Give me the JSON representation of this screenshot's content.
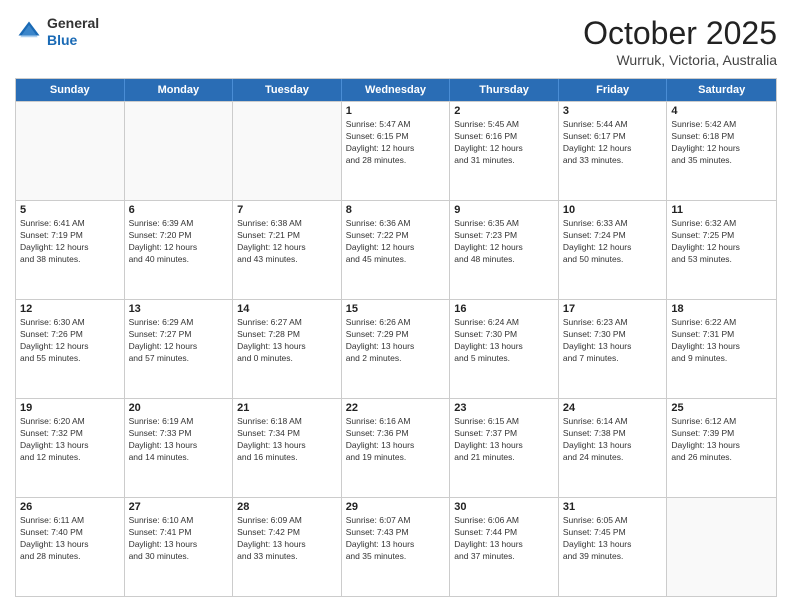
{
  "header": {
    "logo_line1": "General",
    "logo_line2": "Blue",
    "title": "October 2025",
    "location": "Wurruk, Victoria, Australia"
  },
  "weekdays": [
    "Sunday",
    "Monday",
    "Tuesday",
    "Wednesday",
    "Thursday",
    "Friday",
    "Saturday"
  ],
  "rows": [
    [
      {
        "day": "",
        "info": ""
      },
      {
        "day": "",
        "info": ""
      },
      {
        "day": "",
        "info": ""
      },
      {
        "day": "1",
        "info": "Sunrise: 5:47 AM\nSunset: 6:15 PM\nDaylight: 12 hours\nand 28 minutes."
      },
      {
        "day": "2",
        "info": "Sunrise: 5:45 AM\nSunset: 6:16 PM\nDaylight: 12 hours\nand 31 minutes."
      },
      {
        "day": "3",
        "info": "Sunrise: 5:44 AM\nSunset: 6:17 PM\nDaylight: 12 hours\nand 33 minutes."
      },
      {
        "day": "4",
        "info": "Sunrise: 5:42 AM\nSunset: 6:18 PM\nDaylight: 12 hours\nand 35 minutes."
      }
    ],
    [
      {
        "day": "5",
        "info": "Sunrise: 6:41 AM\nSunset: 7:19 PM\nDaylight: 12 hours\nand 38 minutes."
      },
      {
        "day": "6",
        "info": "Sunrise: 6:39 AM\nSunset: 7:20 PM\nDaylight: 12 hours\nand 40 minutes."
      },
      {
        "day": "7",
        "info": "Sunrise: 6:38 AM\nSunset: 7:21 PM\nDaylight: 12 hours\nand 43 minutes."
      },
      {
        "day": "8",
        "info": "Sunrise: 6:36 AM\nSunset: 7:22 PM\nDaylight: 12 hours\nand 45 minutes."
      },
      {
        "day": "9",
        "info": "Sunrise: 6:35 AM\nSunset: 7:23 PM\nDaylight: 12 hours\nand 48 minutes."
      },
      {
        "day": "10",
        "info": "Sunrise: 6:33 AM\nSunset: 7:24 PM\nDaylight: 12 hours\nand 50 minutes."
      },
      {
        "day": "11",
        "info": "Sunrise: 6:32 AM\nSunset: 7:25 PM\nDaylight: 12 hours\nand 53 minutes."
      }
    ],
    [
      {
        "day": "12",
        "info": "Sunrise: 6:30 AM\nSunset: 7:26 PM\nDaylight: 12 hours\nand 55 minutes."
      },
      {
        "day": "13",
        "info": "Sunrise: 6:29 AM\nSunset: 7:27 PM\nDaylight: 12 hours\nand 57 minutes."
      },
      {
        "day": "14",
        "info": "Sunrise: 6:27 AM\nSunset: 7:28 PM\nDaylight: 13 hours\nand 0 minutes."
      },
      {
        "day": "15",
        "info": "Sunrise: 6:26 AM\nSunset: 7:29 PM\nDaylight: 13 hours\nand 2 minutes."
      },
      {
        "day": "16",
        "info": "Sunrise: 6:24 AM\nSunset: 7:30 PM\nDaylight: 13 hours\nand 5 minutes."
      },
      {
        "day": "17",
        "info": "Sunrise: 6:23 AM\nSunset: 7:30 PM\nDaylight: 13 hours\nand 7 minutes."
      },
      {
        "day": "18",
        "info": "Sunrise: 6:22 AM\nSunset: 7:31 PM\nDaylight: 13 hours\nand 9 minutes."
      }
    ],
    [
      {
        "day": "19",
        "info": "Sunrise: 6:20 AM\nSunset: 7:32 PM\nDaylight: 13 hours\nand 12 minutes."
      },
      {
        "day": "20",
        "info": "Sunrise: 6:19 AM\nSunset: 7:33 PM\nDaylight: 13 hours\nand 14 minutes."
      },
      {
        "day": "21",
        "info": "Sunrise: 6:18 AM\nSunset: 7:34 PM\nDaylight: 13 hours\nand 16 minutes."
      },
      {
        "day": "22",
        "info": "Sunrise: 6:16 AM\nSunset: 7:36 PM\nDaylight: 13 hours\nand 19 minutes."
      },
      {
        "day": "23",
        "info": "Sunrise: 6:15 AM\nSunset: 7:37 PM\nDaylight: 13 hours\nand 21 minutes."
      },
      {
        "day": "24",
        "info": "Sunrise: 6:14 AM\nSunset: 7:38 PM\nDaylight: 13 hours\nand 24 minutes."
      },
      {
        "day": "25",
        "info": "Sunrise: 6:12 AM\nSunset: 7:39 PM\nDaylight: 13 hours\nand 26 minutes."
      }
    ],
    [
      {
        "day": "26",
        "info": "Sunrise: 6:11 AM\nSunset: 7:40 PM\nDaylight: 13 hours\nand 28 minutes."
      },
      {
        "day": "27",
        "info": "Sunrise: 6:10 AM\nSunset: 7:41 PM\nDaylight: 13 hours\nand 30 minutes."
      },
      {
        "day": "28",
        "info": "Sunrise: 6:09 AM\nSunset: 7:42 PM\nDaylight: 13 hours\nand 33 minutes."
      },
      {
        "day": "29",
        "info": "Sunrise: 6:07 AM\nSunset: 7:43 PM\nDaylight: 13 hours\nand 35 minutes."
      },
      {
        "day": "30",
        "info": "Sunrise: 6:06 AM\nSunset: 7:44 PM\nDaylight: 13 hours\nand 37 minutes."
      },
      {
        "day": "31",
        "info": "Sunrise: 6:05 AM\nSunset: 7:45 PM\nDaylight: 13 hours\nand 39 minutes."
      },
      {
        "day": "",
        "info": ""
      }
    ]
  ]
}
